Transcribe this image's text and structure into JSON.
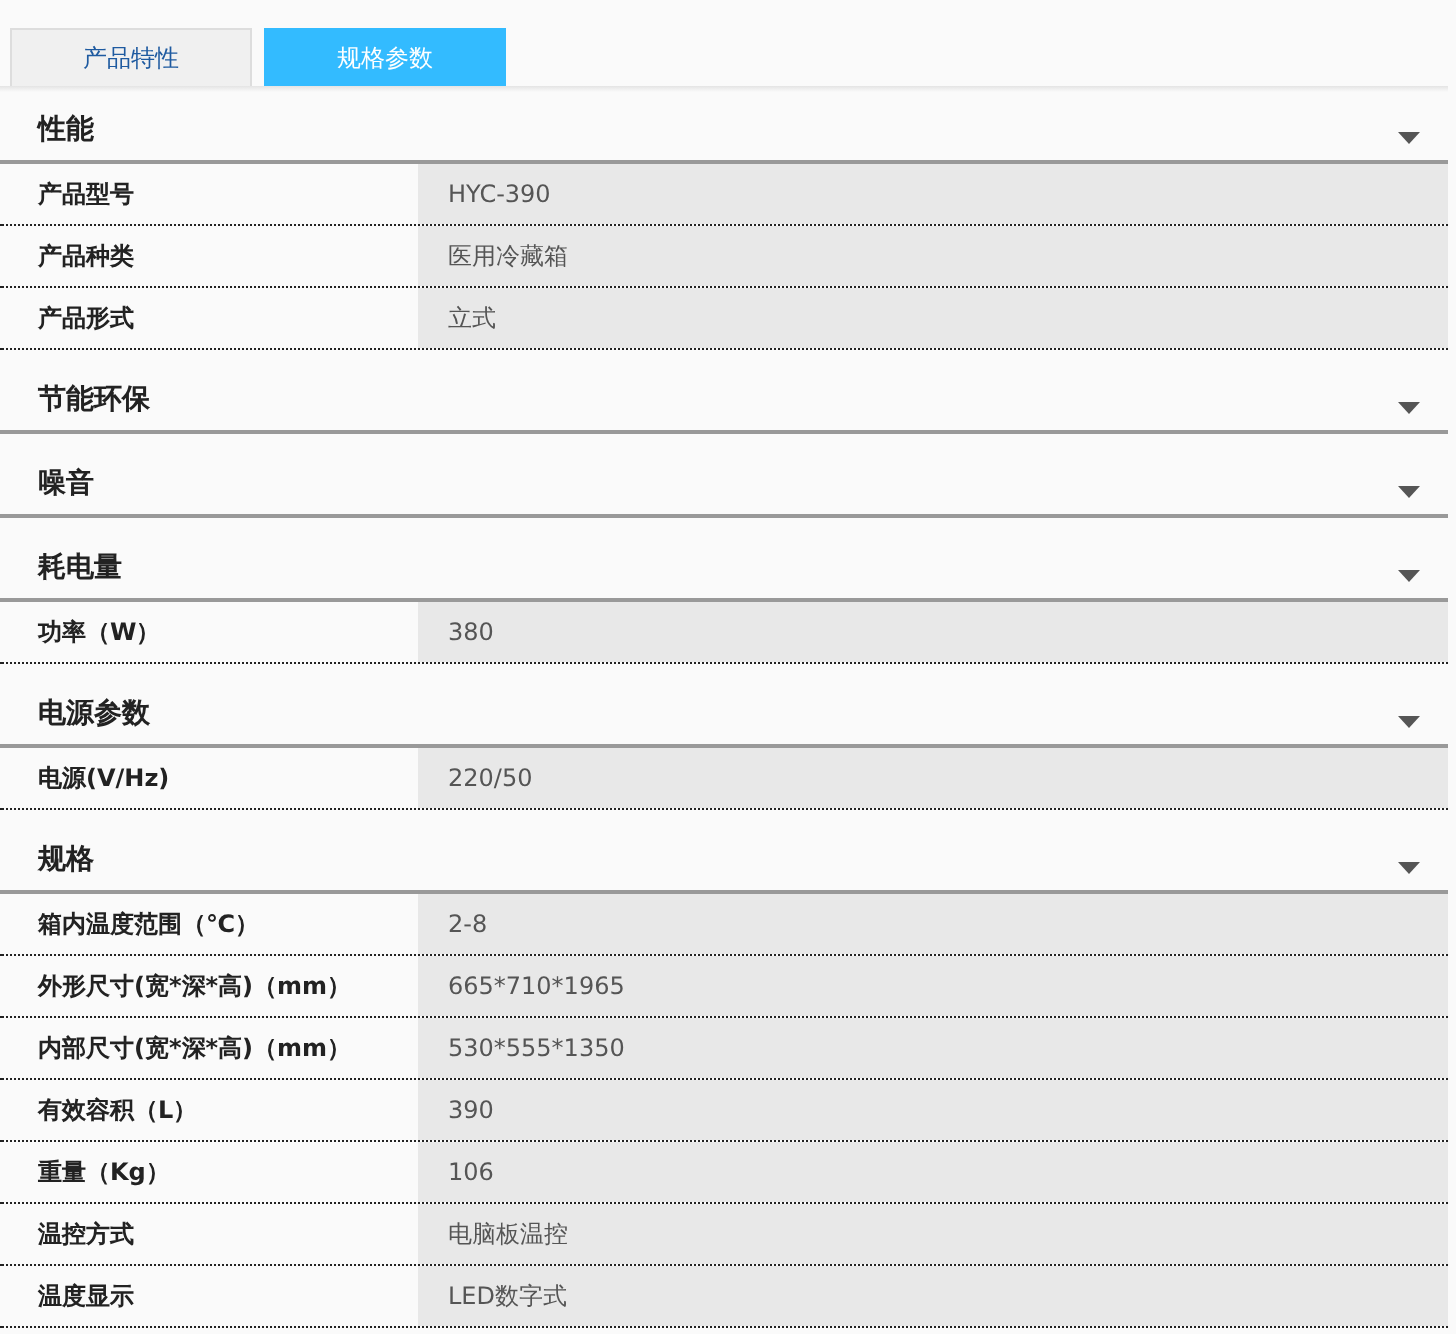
{
  "tabs": [
    {
      "label": "产品特性",
      "selected": false
    },
    {
      "label": "规格参数",
      "selected": true
    }
  ],
  "sections": [
    {
      "title": "性能",
      "rows": [
        {
          "label": "产品型号",
          "value": "HYC-390"
        },
        {
          "label": "产品种类",
          "value": "医用冷藏箱"
        },
        {
          "label": "产品形式",
          "value": "立式"
        }
      ]
    },
    {
      "title": "节能环保"
    },
    {
      "title": "噪音"
    },
    {
      "title": "耗电量",
      "rows": [
        {
          "label": "功率（W）",
          "value": "380"
        }
      ]
    },
    {
      "title": "电源参数",
      "rows": [
        {
          "label": "电源(V/Hz)",
          "value": "220/50"
        }
      ]
    },
    {
      "title": "规格",
      "rows": [
        {
          "label": "箱内温度范围（℃）",
          "value": "2-8"
        },
        {
          "label": "外形尺寸(宽*深*高)（mm）",
          "value": "665*710*1965"
        },
        {
          "label": "内部尺寸(宽*深*高)（mm）",
          "value": "530*555*1350"
        },
        {
          "label": "有效容积（L）",
          "value": "390"
        },
        {
          "label": "重量（Kg）",
          "value": "106"
        },
        {
          "label": "温控方式",
          "value": "电脑板温控"
        },
        {
          "label": "温度显示",
          "value": "LED数字式"
        }
      ]
    }
  ]
}
